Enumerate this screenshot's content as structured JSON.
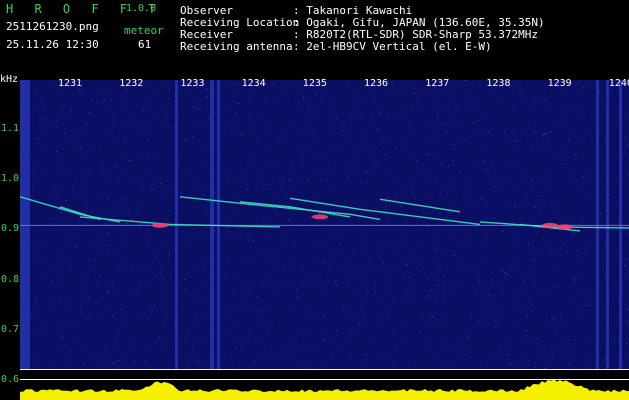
{
  "header": {
    "app_name": "H R O F F T",
    "version": "1.0.0",
    "filename": "2511261230.png",
    "datetime": "25.11.26 12:30",
    "meteor_label": "meteor",
    "meteor_count": "61",
    "observer_label": "Observer",
    "observer_value": ": Takanori Kawachi",
    "location_label": "Receiving Location",
    "location_value": ": Ogaki, Gifu, JAPAN (136.60E, 35.35N)",
    "receiver_label": "Receiver",
    "receiver_value": ": R820T2(RTL-SDR) SDR-Sharp 53.372MHz",
    "antenna_label": "Receiving antenna",
    "antenna_value": ": 2el-HB9CV Vertical (el. E-W)"
  },
  "axes": {
    "y_unit": "kHz",
    "y_ticks": [
      "1.1",
      "1.0",
      "0.9",
      "0.8",
      "0.7",
      "0.6"
    ],
    "x_ticks": [
      "1231",
      "1232",
      "1233",
      "1234",
      "1235",
      "1236",
      "1237",
      "1238",
      "1239",
      "1240"
    ]
  },
  "colors": {
    "background": "#000000",
    "spectrogram": "#0b0f63",
    "label_green": "#39d05a",
    "label_white": "#ffffff",
    "echo_cyan": "#40e0c0",
    "echo_red": "#ff4070",
    "power_yellow": "#f4f000",
    "power_cyan": "#00b8e8"
  },
  "chart_data": {
    "type": "heatmap",
    "y_range_khz": [
      0.58,
      1.17
    ],
    "x_range_minutes": [
      "12:30",
      "12:40"
    ],
    "y_ticks": [
      1.1,
      1.0,
      0.9,
      0.8,
      0.7,
      0.6
    ],
    "x_ticks": [
      "1231",
      "1232",
      "1233",
      "1234",
      "1235",
      "1236",
      "1237",
      "1238",
      "1239",
      "1240"
    ],
    "carrier_khz": 0.908,
    "meteor_count": 61
  }
}
